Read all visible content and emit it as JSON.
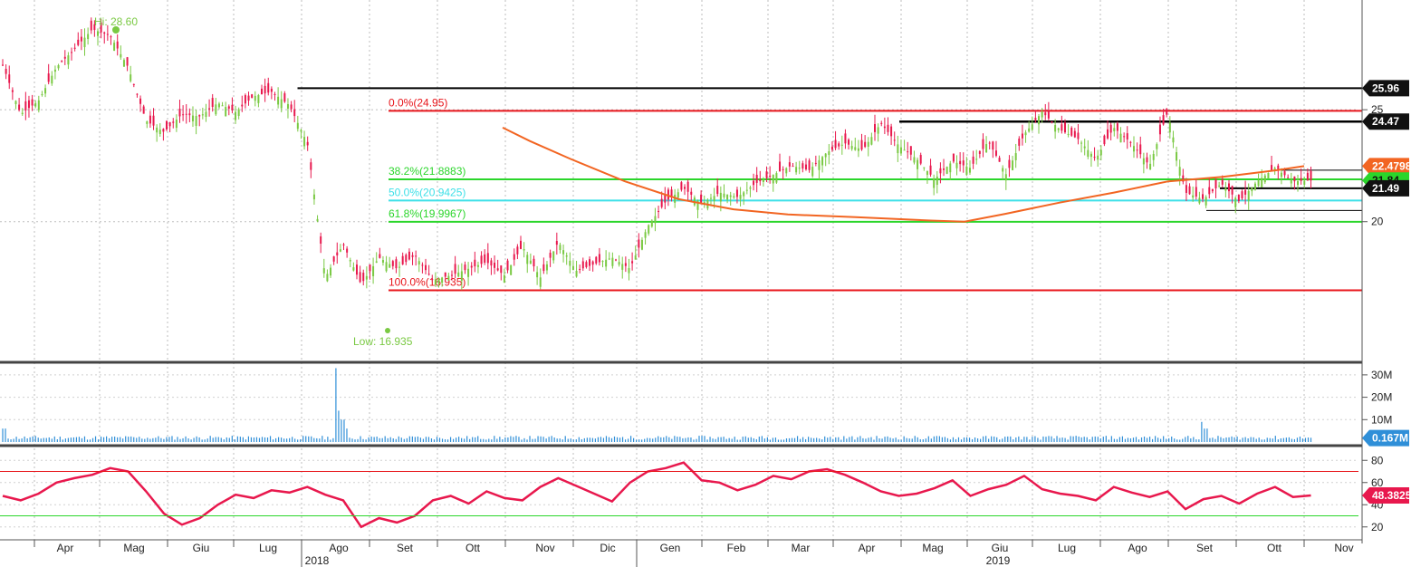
{
  "chart_data": [
    {
      "type": "candlestick",
      "panel": "price",
      "hi_label": "Hi: 28.60",
      "low_label": "Low: 16.935",
      "y_ticks": [
        "25",
        "20"
      ],
      "ylim": [
        13.8,
        29.9
      ],
      "x_ticks": [
        "Apr",
        "Mag",
        "Giu",
        "Lug",
        "Ago",
        "Set",
        "Ott",
        "Nov",
        "Dic",
        "Gen",
        "Feb",
        "Mar",
        "Apr",
        "Mag",
        "Giu",
        "Lug",
        "Ago",
        "Set",
        "Ott",
        "Nov"
      ],
      "years": [
        "2018",
        "2019"
      ],
      "fibonacci": [
        {
          "label": "0.0%(24.95)",
          "value": 24.95,
          "color": "#e8151b"
        },
        {
          "label": "38.2%(21.8883)",
          "value": 21.8883,
          "color": "#2bd62b"
        },
        {
          "label": "50.0%(20.9425)",
          "value": 20.9425,
          "color": "#3ee0e8"
        },
        {
          "label": "61.8%(19.9967)",
          "value": 19.9967,
          "color": "#2bd62b"
        },
        {
          "label": "100.0%(16.935)",
          "value": 16.935,
          "color": "#e8151b"
        }
      ],
      "horizontal_levels": [
        {
          "value": 25.96,
          "label": "25.96"
        },
        {
          "value": 24.47,
          "label": "24.47"
        },
        {
          "value": 21.49,
          "label": "21.49"
        }
      ],
      "last_price_label": "21.84",
      "moving_average": {
        "last": "22.4798",
        "color": "#f26522"
      },
      "up_color": "#7ac943",
      "down_color": "#e8184d",
      "close_series": [
        27.0,
        24.8,
        25.4,
        26.9,
        27.7,
        28.6,
        28.3,
        26.9,
        24.5,
        24.0,
        24.8,
        24.7,
        25.3,
        24.9,
        25.6,
        25.8,
        25.2,
        23.5,
        17.5,
        19.0,
        17.2,
        18.4,
        17.9,
        18.5,
        17.4,
        17.6,
        17.9,
        18.2,
        17.6,
        18.9,
        17.5,
        19.1,
        17.8,
        18.1,
        18.4,
        17.9,
        19.8,
        20.9,
        21.5,
        20.8,
        21.3,
        21.1,
        21.7,
        22.1,
        22.5,
        22.3,
        23.1,
        23.5,
        23.2,
        24.4,
        23.4,
        22.8,
        21.9,
        22.7,
        22.4,
        23.6,
        22.1,
        23.9,
        24.9,
        24.1,
        23.7,
        22.8,
        24.2,
        23.5,
        22.5,
        24.9,
        21.3,
        21.0,
        21.7,
        20.9,
        21.8,
        22.4,
        21.8,
        21.84
      ],
      "ma_points": [
        [
          0.37,
          24.2
        ],
        [
          0.39,
          23.6
        ],
        [
          0.42,
          22.8
        ],
        [
          0.46,
          21.8
        ],
        [
          0.5,
          21.0
        ],
        [
          0.54,
          20.55
        ],
        [
          0.58,
          20.32
        ],
        [
          0.63,
          20.2
        ],
        [
          0.685,
          20.05
        ],
        [
          0.71,
          20.0
        ],
        [
          0.74,
          20.35
        ],
        [
          0.78,
          20.85
        ],
        [
          0.82,
          21.3
        ],
        [
          0.86,
          21.8
        ],
        [
          0.9,
          22.0
        ],
        [
          0.94,
          22.3
        ],
        [
          0.96,
          22.4798
        ]
      ]
    },
    {
      "type": "bar",
      "panel": "volume",
      "y_ticks": [
        "30M",
        "20M",
        "10M"
      ],
      "ylim": [
        0,
        34
      ],
      "last_label": "0.167M",
      "color": "#2f8fd8",
      "spikes": [
        [
          0.248,
          33
        ],
        [
          0.25,
          14
        ],
        [
          0.252,
          10
        ],
        [
          0.255,
          6
        ],
        [
          0.885,
          9
        ],
        [
          0.888,
          6
        ]
      ]
    },
    {
      "type": "line",
      "panel": "rsi",
      "y_ticks": [
        "80",
        "60",
        "40",
        "20"
      ],
      "ylim": [
        10,
        90
      ],
      "upper_band": 70,
      "lower_band": 30,
      "last_label": "48.3825",
      "color": "#e8184d",
      "values": [
        48,
        44,
        50,
        60,
        64,
        67,
        73,
        70,
        52,
        32,
        22,
        28,
        40,
        49,
        46,
        53,
        51,
        56,
        49,
        44,
        20,
        28,
        24,
        30,
        44,
        48,
        41,
        52,
        46,
        44,
        56,
        64,
        57,
        50,
        43,
        60,
        70,
        73,
        78,
        62,
        60,
        53,
        58,
        66,
        63,
        70,
        72,
        67,
        60,
        52,
        48,
        50,
        55,
        62,
        48,
        54,
        58,
        66,
        54,
        50,
        48,
        44,
        56,
        51,
        47,
        52,
        36,
        45,
        48,
        41,
        50,
        56,
        47,
        48.38
      ]
    }
  ]
}
